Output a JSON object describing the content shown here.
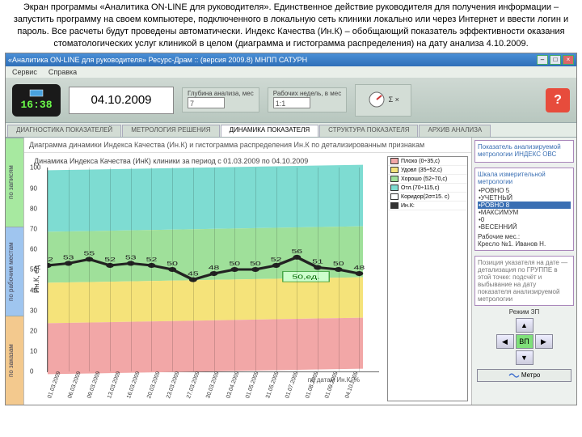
{
  "caption": "Экран программы «Аналитика ON-LINE для руководителя». Единственное действие руководителя для получения информации – запустить программу на своем компьютере, подключенного в локальную сеть клиники локально или через Интернет и ввести логин и пароль. Все расчеты будут проведены автоматически. Индекс Качества (Ин.К) – обобщающий показатель эффективности оказания стоматологических услуг клиникой в целом (диаграмма и гистограмма распределения) на дату анализа 4.10.2009.",
  "window": {
    "title": "«Аналитика ON-LINE для руководителя» Ресурс-Драм :: (версия 2009.8) МНПП САТУРН"
  },
  "menubar": [
    "Сервис",
    "Справка"
  ],
  "toolbar": {
    "clock": "16:38",
    "date": "04.10.2009",
    "group1": {
      "label": "Глубина анализа, мес",
      "value": "7"
    },
    "group2": {
      "label": "Рабочих недель, в мес",
      "value": "1:1"
    },
    "help": "?"
  },
  "tabs": [
    "ДИАГНОСТИКА ПОКАЗАТЕЛЕЙ",
    "МЕТРОЛОГИЯ РЕШЕНИЯ",
    "ДИНАМИКА ПОКАЗАТЕЛЯ",
    "СТРУКТУРА ПОКАЗАТЕЛЯ",
    "АРХИВ АНАЛИЗА"
  ],
  "active_tab": 2,
  "left_tabs": [
    "по записям",
    "по рабочим местам",
    "по заказам"
  ],
  "subtitle": "Диаграмма динамики Индекса Качества (Ин.К) и гистограмма распределения Ин.К по детализированным признакам",
  "chart_title": "Динамика Индекса Качества (ИнК) клиники за период с 01.03.2009 по 04.10.2009",
  "ylabel": "Ин.К, ед",
  "xaxis_title": "по датам Ин.К, %",
  "legend": [
    {
      "label": "Плохо (0÷35,с)",
      "color": "#f2a7a7"
    },
    {
      "label": "Удовл (35÷52,с)",
      "color": "#f5e37a"
    },
    {
      "label": "Хорошо (52÷70,с)",
      "color": "#9fe09a"
    },
    {
      "label": "Отл.(70÷115,с)",
      "color": "#7edcd2"
    },
    {
      "label": "Коридор(2σ=15. с)",
      "color": "#ffffff"
    },
    {
      "label": "Ин.К:",
      "color": "#333333"
    }
  ],
  "chart_data": {
    "type": "line",
    "ylim": [
      0,
      100
    ],
    "yticks": [
      0,
      10,
      20,
      30,
      40,
      50,
      60,
      70,
      80,
      90,
      100
    ],
    "bands": [
      {
        "name": "Плохо",
        "from": 0,
        "to": 35,
        "color": "#f2a7a7"
      },
      {
        "name": "Удовл",
        "from": 35,
        "to": 52,
        "color": "#f5e37a"
      },
      {
        "name": "Хорошо",
        "from": 52,
        "to": 70,
        "color": "#9fe09a"
      },
      {
        "name": "Отл",
        "from": 70,
        "to": 115,
        "color": "#7edcd2"
      }
    ],
    "x": [
      "01.03.2009",
      "06.03.2009",
      "09.03.2009",
      "13.03.2009",
      "16.03.2009",
      "20.03.2009",
      "23.03.2009",
      "27.03.2009",
      "30.03.2009",
      "03.04.2009",
      "01.05.2009",
      "31.05.2009",
      "01.07.2009",
      "01.08.2009",
      "01.09.2009",
      "04.10.2009"
    ],
    "values": [
      52,
      53,
      55,
      52,
      53,
      52,
      50,
      45,
      48,
      50,
      50,
      52,
      56,
      51,
      50,
      48
    ],
    "callout": {
      "label": "50,ед.",
      "index": 11
    }
  },
  "right": {
    "hd1": "Показатель анализируемой метрологии ИНДЕКС ОВС",
    "scale_hd": "Шкала измерительной метрологии",
    "scales": [
      "•РОВНО 5",
      "•УЧЕТНЫЙ",
      "•РОВНО 8",
      "•МАКСИМУМ",
      "•0",
      "•ВЕСЕННИЙ"
    ],
    "scale_sel": 2,
    "rab": "Рабочие мес.:",
    "rab_val": "Кресло №1. Иванов Н.",
    "note": "Позиция указателя на дате — детализация по ГРУППЕ в этой точке: подсчёт и выбывание на дату показателя анализируемой метрологии",
    "rej": "Режим ЗП",
    "center_btn": "ВП",
    "met_btn": "Метро"
  }
}
